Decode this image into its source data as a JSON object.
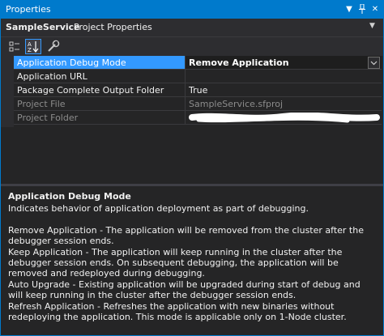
{
  "window": {
    "title": "Properties"
  },
  "object": {
    "name": "SampleService",
    "type": "Project Properties"
  },
  "toolbar": {
    "buttons": [
      {
        "icon": "categorized-icon",
        "active": false
      },
      {
        "icon": "alphabetical-icon",
        "active": true
      },
      {
        "icon": "property-pages-icon",
        "active": false
      }
    ]
  },
  "properties": [
    {
      "name": "Application Debug Mode",
      "value": "Remove Application",
      "selected": true,
      "readonly": false
    },
    {
      "name": "Application URL",
      "value": "",
      "selected": false,
      "readonly": false
    },
    {
      "name": "Package Complete Output Folder",
      "value": "True",
      "selected": false,
      "readonly": false
    },
    {
      "name": "Project File",
      "value": "SampleService.sfproj",
      "selected": false,
      "readonly": true
    },
    {
      "name": "Project Folder",
      "value": "",
      "selected": false,
      "readonly": true
    }
  ],
  "description": {
    "title": "Application Debug Mode",
    "text": "Indicates behavior of application deployment as part of debugging.\n\nRemove Application - The application will be removed from the cluster after the debugger session ends.\nKeep Application - The application will keep running in the cluster after the debugger session ends. On subsequent debugging, the application will be removed and redeployed during debugging.\nAuto Upgrade - Existing application will be upgraded during start of debug and will keep running in the cluster after the debugger session ends.\nRefresh Application - Refreshes the application with new binaries without redeploying the application. This mode is applicable only on 1-Node cluster."
  },
  "colors": {
    "accent": "#007acc",
    "selection": "#3399ff",
    "background": "#252526",
    "readonly_text": "#8c8c8c"
  }
}
